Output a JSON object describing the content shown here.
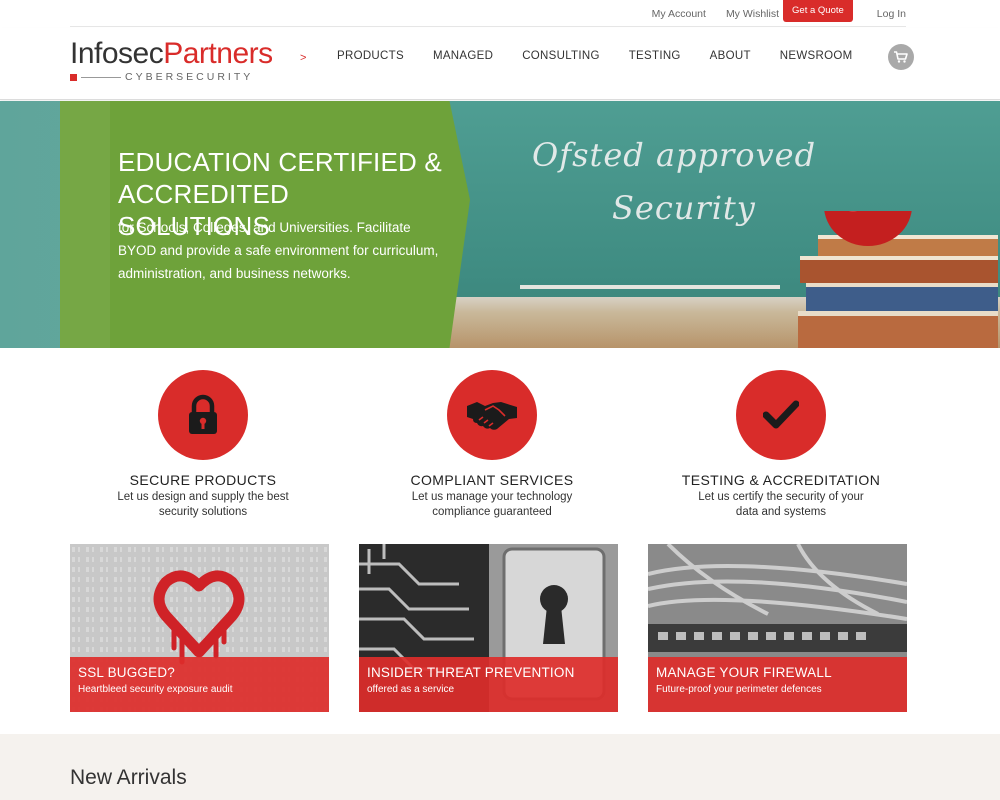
{
  "topbar": {
    "my_account": "My Account",
    "my_wishlist": "My Wishlist",
    "get_quote": "Get a Quote",
    "log_in": "Log In"
  },
  "logo": {
    "part1": "Infosec",
    "part2": "Partners",
    "tagline": "CYBERSECURITY"
  },
  "nav": {
    "arrow": ">",
    "items": [
      "PRODUCTS",
      "MANAGED",
      "CONSULTING",
      "TESTING",
      "ABOUT",
      "NEWSROOM"
    ]
  },
  "hero": {
    "title": "EDUCATION CERTIFIED & ACCREDITED SOLUTIONS",
    "text": "for Schools, Colleges, and Universities. Facilitate BYOD and provide a safe environment for curriculum, administration, and business networks.",
    "chalk_line1": "Ofsted approved",
    "chalk_line2": "Security"
  },
  "features": [
    {
      "icon": "padlock-icon",
      "title": "SECURE PRODUCTS",
      "text": "Let us design and supply the best security solutions"
    },
    {
      "icon": "handshake-icon",
      "title": "COMPLIANT SERVICES",
      "text": "Let us manage your technology compliance guaranteed"
    },
    {
      "icon": "checkmark-icon",
      "title": "TESTING & ACCREDITATION",
      "text": "Let us certify the security of your data and systems"
    }
  ],
  "cards": [
    {
      "title": "SSL BUGGED?",
      "text": "Heartbleed security exposure audit"
    },
    {
      "title": "INSIDER THREAT PREVENTION",
      "text": "offered as a service"
    },
    {
      "title": "MANAGE YOUR FIREWALL",
      "text": "Future-proof your perimeter defences"
    }
  ],
  "bottom": {
    "title": "New Arrivals"
  },
  "colors": {
    "accent": "#d92c2a",
    "hero_green": "#6ea23a",
    "hero_teal": "#5fa59b"
  }
}
